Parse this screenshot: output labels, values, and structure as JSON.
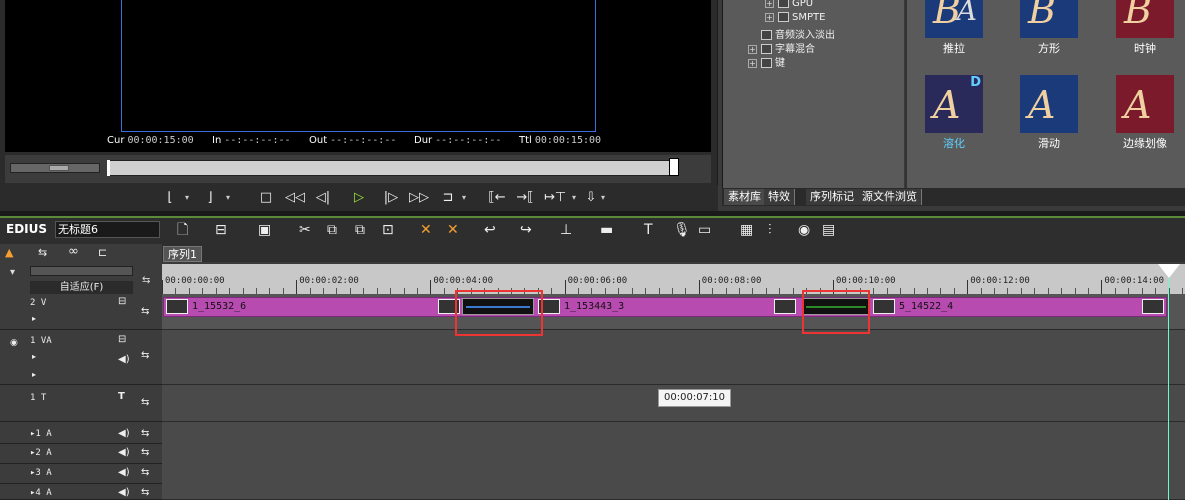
{
  "preview": {
    "timecodes": [
      {
        "label": "Cur",
        "value": "00:00:15:00"
      },
      {
        "label": "In",
        "value": "--:--:--:--"
      },
      {
        "label": "Out",
        "value": "--:--:--:--"
      },
      {
        "label": "Dur",
        "value": "--:--:--:--"
      },
      {
        "label": "Ttl",
        "value": "00:00:15:00"
      }
    ]
  },
  "tree": {
    "items": [
      {
        "label": "GPU"
      },
      {
        "label": "SMPTE"
      },
      {
        "label": "音频淡入淡出"
      },
      {
        "label": "字幕混合"
      },
      {
        "label": "键"
      }
    ]
  },
  "effects": [
    {
      "label": "推拉",
      "letter": "B",
      "letter2": "A",
      "bg": "#1a3a7a"
    },
    {
      "label": "方形",
      "letter": "B",
      "letter2": "",
      "bg": "#1a3a7a"
    },
    {
      "label": "时钟",
      "letter": "B",
      "letter2": "",
      "bg": "#7a1a2a"
    },
    {
      "label": "溶化",
      "letter": "A",
      "letter2": "D",
      "bg": "#2a2a5a"
    },
    {
      "label": "滑动",
      "letter": "A",
      "letter2": "",
      "bg": "#1a3a7a"
    },
    {
      "label": "边缘划像",
      "letter": "A",
      "letter2": "",
      "bg": "#7a1a2a"
    }
  ],
  "bottom_tabs": [
    "素材库",
    "特效",
    "序列标记",
    "源文件浏览"
  ],
  "timeline": {
    "app_name": "EDIUS",
    "project_name": "无标题6",
    "sequence_tab": "序列1",
    "fit_label": "自适应(F)",
    "ruler_ticks": [
      "00:00:00:00",
      "00:00:02:00",
      "00:00:04:00",
      "00:00:06:00",
      "00:00:08:00",
      "00:00:10:00",
      "00:00:12:00",
      "00:00:14:00"
    ],
    "tracks": [
      {
        "name": "2 V"
      },
      {
        "name": "1 VA"
      },
      {
        "name": "1 T"
      },
      {
        "name": "1 A"
      },
      {
        "name": "2 A"
      },
      {
        "name": "3 A"
      },
      {
        "name": "4 A"
      }
    ],
    "clips": [
      {
        "label": "1_15532_6"
      },
      {
        "label": "1_153443_3"
      },
      {
        "label": "5_14522_4"
      }
    ],
    "tooltip": "00:00:07:10"
  }
}
